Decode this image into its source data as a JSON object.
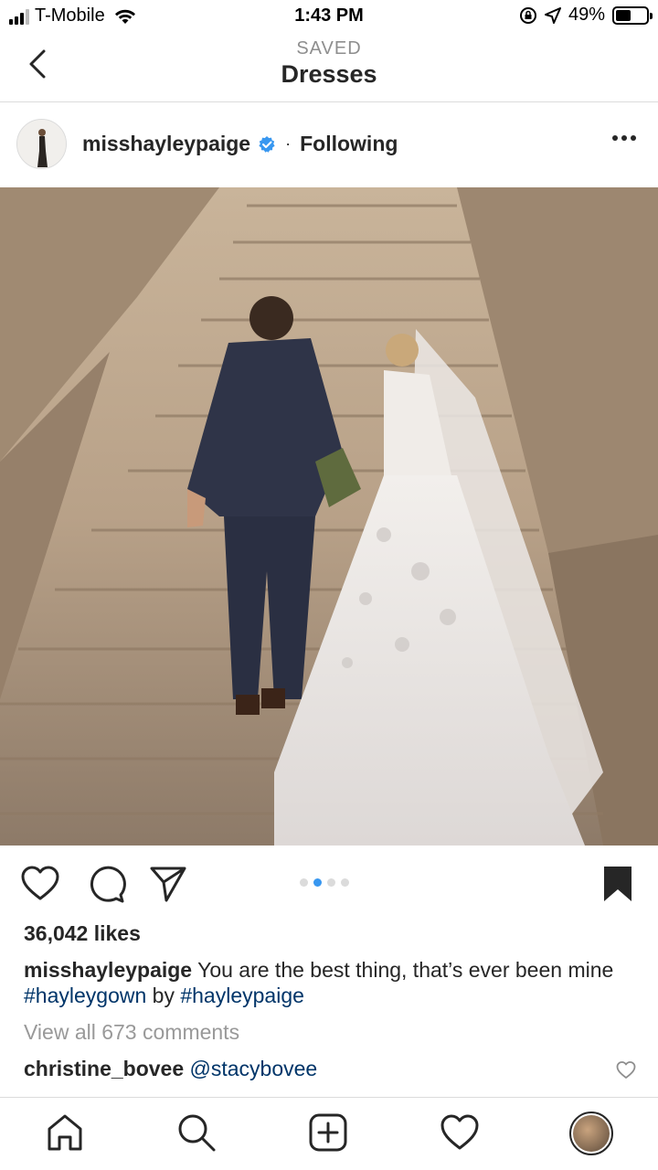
{
  "status_bar": {
    "carrier": "T-Mobile",
    "time": "1:43 PM",
    "battery": "49%",
    "battery_level": 0.49
  },
  "header": {
    "subtitle": "SAVED",
    "title": "Dresses"
  },
  "post": {
    "username": "misshayleypaige",
    "separator": "·",
    "follow_status": "Following",
    "carousel": {
      "count": 4,
      "active_index": 1
    },
    "likes": "36,042 likes",
    "caption": {
      "username": "misshayleypaige",
      "text_1": "You are the best thing, that’s ever been mine",
      "hashtag_1": "#hayleygown",
      "text_2": "by",
      "hashtag_2": "#hayleypaige"
    },
    "view_comments": "View all 673 comments",
    "comment": {
      "username": "christine_bovee",
      "mention": "@stacybovee"
    }
  },
  "colors": {
    "link": "#003569",
    "verified": "#3897f0",
    "muted": "#999999",
    "text": "#262626"
  },
  "icons": {
    "status": [
      "signal-icon",
      "wifi-icon",
      "location-icon",
      "battery-icon"
    ],
    "actions": [
      "heart-icon",
      "comment-icon",
      "share-icon",
      "bookmark-icon"
    ],
    "tabs": [
      "home-icon",
      "search-icon",
      "add-post-icon",
      "activity-heart-icon",
      "profile-avatar"
    ]
  }
}
